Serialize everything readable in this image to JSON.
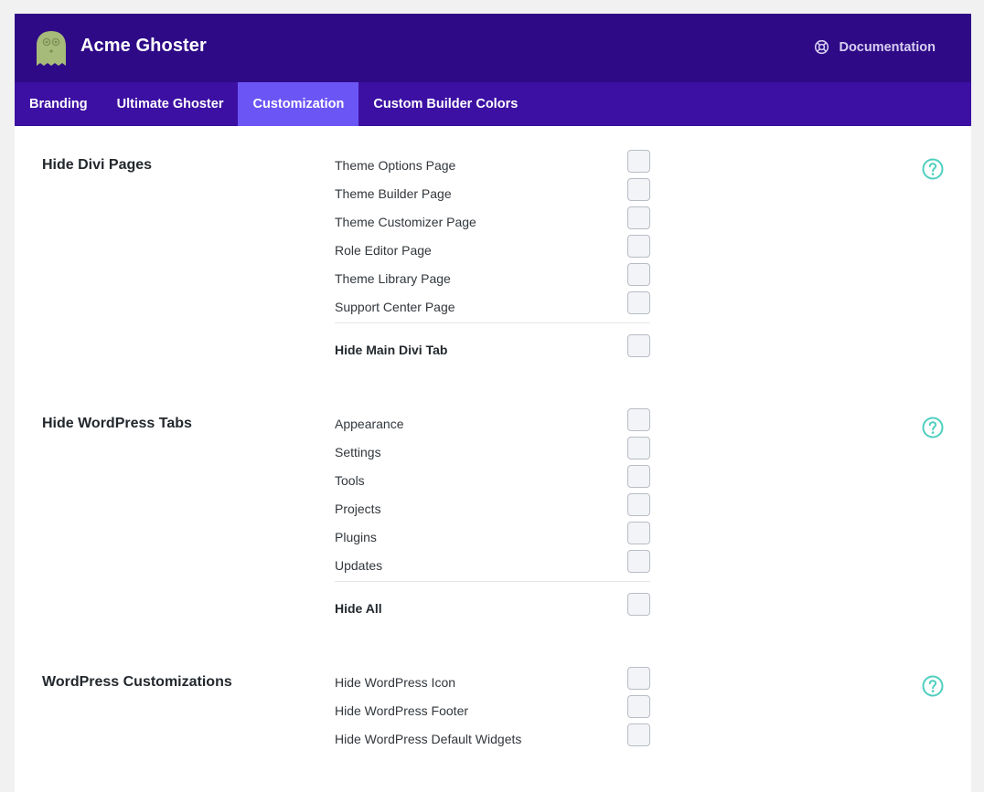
{
  "header": {
    "title": "Acme Ghoster",
    "documentation_label": "Documentation",
    "logo_icon": "ghost-icon",
    "doc_icon": "lifebuoy-icon"
  },
  "tabs": [
    {
      "label": "Branding",
      "active": false
    },
    {
      "label": "Ultimate Ghoster",
      "active": false
    },
    {
      "label": "Customization",
      "active": true
    },
    {
      "label": "Custom Builder Colors",
      "active": false
    }
  ],
  "sections": [
    {
      "title": "Hide Divi Pages",
      "options": [
        "Theme Options Page",
        "Theme Builder Page",
        "Theme Customizer Page",
        "Role Editor Page",
        "Theme Library Page",
        "Support Center Page"
      ],
      "master": "Hide Main Divi Tab"
    },
    {
      "title": "Hide WordPress Tabs",
      "options": [
        "Appearance",
        "Settings",
        "Tools",
        "Projects",
        "Plugins",
        "Updates"
      ],
      "master": "Hide All"
    },
    {
      "title": "WordPress Customizations",
      "options": [
        "Hide WordPress Icon",
        "Hide WordPress Footer",
        "Hide WordPress Default Widgets"
      ]
    }
  ],
  "colors": {
    "header_bg": "#2e0a87",
    "tabs_bg": "#3c10a3",
    "active_tab_bg": "#6c55f5",
    "help_icon": "#4fcfc0",
    "logo": "#a6ba7a"
  }
}
